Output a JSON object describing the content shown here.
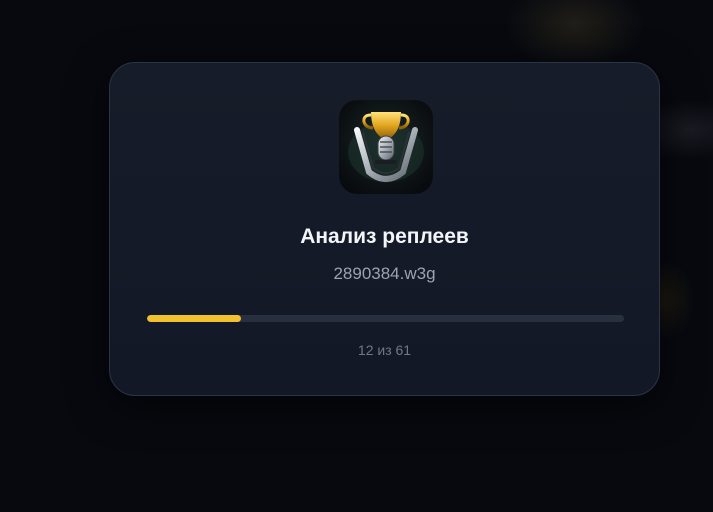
{
  "dialog": {
    "title": "Анализ реплеев",
    "current_file": "2890384.w3g",
    "progress": {
      "current": 12,
      "total": 61,
      "label": "12 из 61"
    },
    "icon": "trophy-microphone-icon",
    "accent_color": "#f2c12e"
  }
}
